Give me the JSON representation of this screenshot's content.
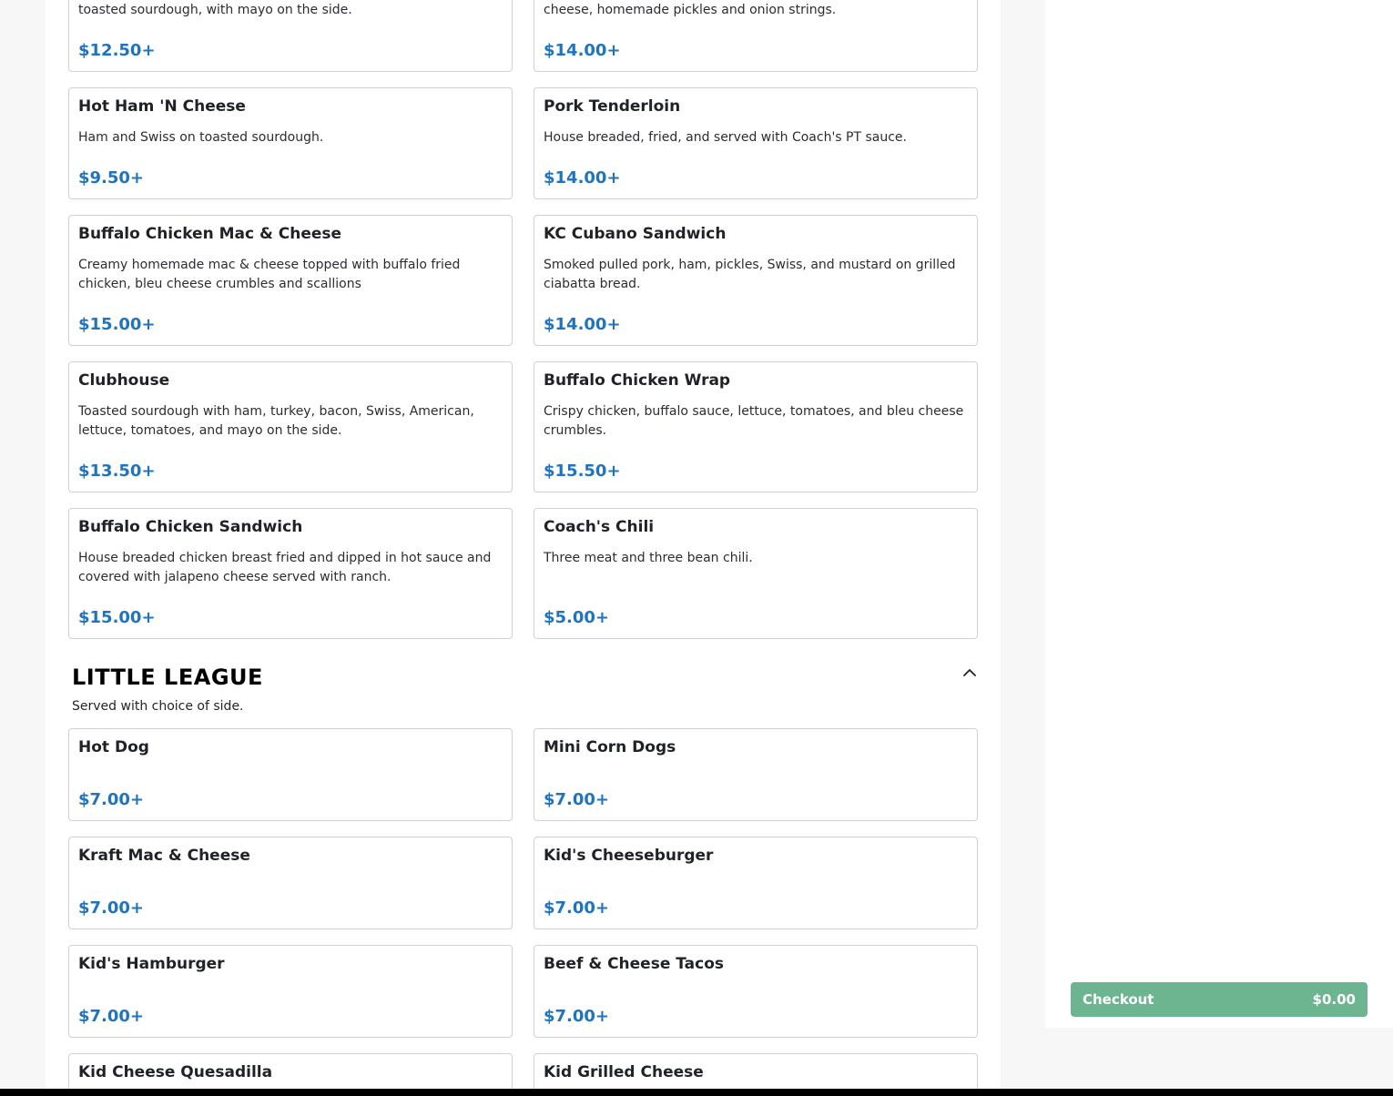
{
  "menu": {
    "items_top": [
      {
        "desc": "toasted sourdough, with mayo on the side.",
        "price": "$12.50+"
      },
      {
        "desc": "cheese, homemade pickles and onion strings.",
        "price": "$14.00+"
      },
      {
        "name": "Hot Ham 'N Cheese",
        "desc": "Ham and Swiss on toasted sourdough.",
        "price": "$9.50+"
      },
      {
        "name": "Pork Tenderloin",
        "desc": "House breaded, fried, and served with Coach's PT sauce.",
        "price": "$14.00+"
      },
      {
        "name": "Buffalo Chicken Mac & Cheese",
        "desc": "Creamy homemade mac & cheese topped with buffalo fried chicken, bleu cheese crumbles and scallions",
        "price": "$15.00+"
      },
      {
        "name": "KC Cubano Sandwich",
        "desc": "Smoked pulled pork, ham, pickles, Swiss, and mustard on grilled ciabatta bread.",
        "price": "$14.00+"
      },
      {
        "name": "Clubhouse",
        "desc": "Toasted sourdough with ham, turkey, bacon, Swiss, American, lettuce, tomatoes, and mayo on the side.",
        "price": "$13.50+"
      },
      {
        "name": "Buffalo Chicken Wrap",
        "desc": "Crispy chicken, buffalo sauce, lettuce, tomatoes, and bleu cheese crumbles.",
        "price": "$15.50+"
      },
      {
        "name": "Buffalo Chicken Sandwich",
        "desc": "House breaded chicken breast fried and dipped in hot sauce and covered with jalapeno cheese served with ranch.",
        "price": "$15.00+"
      },
      {
        "name": "Coach's Chili",
        "desc": "Three meat and three bean chili.",
        "price": "$5.00+"
      }
    ],
    "little_league": {
      "title": "LITTLE LEAGUE",
      "subtitle": "Served with choice of side.",
      "items": [
        {
          "name": "Hot Dog",
          "price": "$7.00+"
        },
        {
          "name": "Mini Corn Dogs",
          "price": "$7.00+"
        },
        {
          "name": "Kraft Mac & Cheese",
          "price": "$7.00+"
        },
        {
          "name": "Kid's Cheeseburger",
          "price": "$7.00+"
        },
        {
          "name": "Kid's Hamburger",
          "price": "$7.00+"
        },
        {
          "name": "Beef & Cheese Tacos",
          "price": "$7.00+"
        },
        {
          "name": "Kid Cheese Quesadilla"
        },
        {
          "name": "Kid Grilled Cheese"
        }
      ]
    }
  },
  "cart": {
    "checkout_label": "Checkout",
    "total": "$0.00"
  },
  "icons": {
    "collapse": "chevron-up-icon"
  },
  "colors": {
    "price": "#1f74c0",
    "checkout": "#6db491"
  }
}
